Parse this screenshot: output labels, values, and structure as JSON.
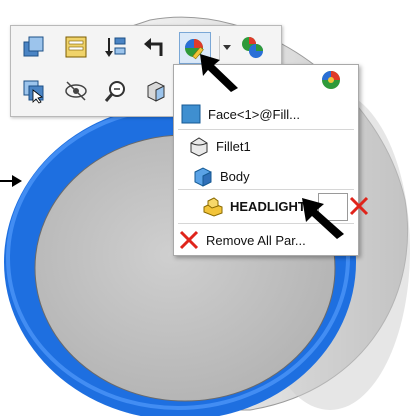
{
  "colors": {
    "accent": "#1e6fe0",
    "remove_red": "#e0241b",
    "face_blue": "#2b7fd0"
  },
  "toolbar": {
    "row1": [
      "appearances-icon",
      "display-pane-icon",
      "sort-icon",
      "back-arrow-icon",
      "edit-appearance-icon",
      "appearances-callout-icon"
    ],
    "row2": [
      "select-other-icon",
      "hide-show-icon",
      "zoom-to-selection-icon",
      "view-orientation-icon"
    ]
  },
  "menu": {
    "items": [
      {
        "label": "Face<1>@Fill...",
        "icon": "face-icon"
      },
      {
        "label": "Fillet1",
        "icon": "fillet-icon"
      },
      {
        "label": "Body",
        "icon": "body-icon"
      },
      {
        "label": "HEADLIGHT",
        "icon": "part-icon"
      },
      {
        "label": "Remove All Par...",
        "icon": "remove-icon"
      }
    ]
  }
}
